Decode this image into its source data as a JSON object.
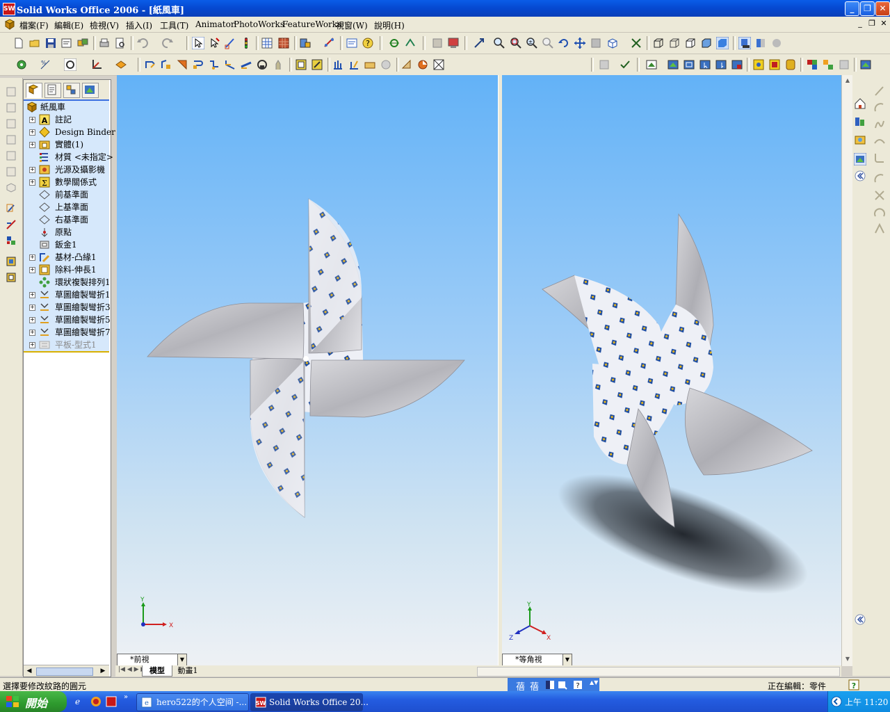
{
  "window": {
    "title": "Solid Works Office 2006 - [紙風車]",
    "app_icon": "SW",
    "controls": {
      "minimize": "_",
      "maximize": "❐",
      "close": "✕"
    }
  },
  "menu": {
    "items": [
      "檔案(F)",
      "編輯(E)",
      "檢視(V)",
      "插入(I)",
      "工具(T)",
      "Animator",
      "PhotoWorks",
      "FeatureWorks",
      "視窗(W)",
      "說明(H)"
    ],
    "doc_controls": {
      "minimize": "_",
      "restore": "❐",
      "close": "✕"
    }
  },
  "tree": {
    "items": [
      {
        "label": "紙風車",
        "icon": "part-icon",
        "expand": ""
      },
      {
        "label": "註記",
        "icon": "annotation-icon",
        "expand": "+"
      },
      {
        "label": "Design Binder",
        "icon": "design-binder-icon",
        "expand": "+"
      },
      {
        "label": "實體(1)",
        "icon": "solid-bodies-icon",
        "expand": "+"
      },
      {
        "label": "材質 <未指定>",
        "icon": "material-icon",
        "expand": ""
      },
      {
        "label": "光源及攝影機",
        "icon": "lights-cameras-icon",
        "expand": "+"
      },
      {
        "label": "數學關係式",
        "icon": "equations-icon",
        "expand": "+"
      },
      {
        "label": "前基準面",
        "icon": "plane-icon",
        "expand": ""
      },
      {
        "label": "上基準面",
        "icon": "plane-icon",
        "expand": ""
      },
      {
        "label": "右基準面",
        "icon": "plane-icon",
        "expand": ""
      },
      {
        "label": "原點",
        "icon": "origin-icon",
        "expand": ""
      },
      {
        "label": "鈑金1",
        "icon": "sheet-metal-icon",
        "expand": ""
      },
      {
        "label": "基材-凸緣1",
        "icon": "base-flange-icon",
        "expand": "+"
      },
      {
        "label": "除料-伸長1",
        "icon": "cut-extrude-icon",
        "expand": "+"
      },
      {
        "label": "環狀複製排列1",
        "icon": "circular-pattern-icon",
        "expand": ""
      },
      {
        "label": "草圖繪製彎折1",
        "icon": "sketched-bend-icon",
        "expand": "+"
      },
      {
        "label": "草圖繪製彎折3",
        "icon": "sketched-bend-icon",
        "expand": "+"
      },
      {
        "label": "草圖繪製彎折5",
        "icon": "sketched-bend-icon",
        "expand": "+"
      },
      {
        "label": "草圖繪製彎折7",
        "icon": "sketched-bend-icon",
        "expand": "+"
      },
      {
        "label": "平板-型式1",
        "icon": "flat-pattern-icon",
        "expand": "+",
        "suppressed": true
      }
    ]
  },
  "views": {
    "left": {
      "label": "*前視",
      "axes": {
        "y": "Y",
        "x": "X"
      }
    },
    "right": {
      "label": "*等角視",
      "axes": {
        "y": "Y",
        "x": "X",
        "z": "Z"
      }
    }
  },
  "bottom_tabs": [
    "模型",
    "動畫1"
  ],
  "status": {
    "message": "選擇要修改紋路的圓元",
    "editing": "正在編輯：零件"
  },
  "ime": {
    "chars": [
      "蓓",
      "蓓"
    ]
  },
  "taskbar": {
    "start": "開始",
    "tasks": [
      "hero522的个人空间 -...",
      "Solid Works Office 20..."
    ],
    "clock": "上午 11:20"
  },
  "colors": {
    "titlebar": "#0548d0",
    "tree_bg": "#d6e8fb",
    "viewport_top": "#63b2f7",
    "viewport_bottom": "#eef1f4",
    "taskbar": "#245ce0",
    "start": "#2e9a2e"
  }
}
